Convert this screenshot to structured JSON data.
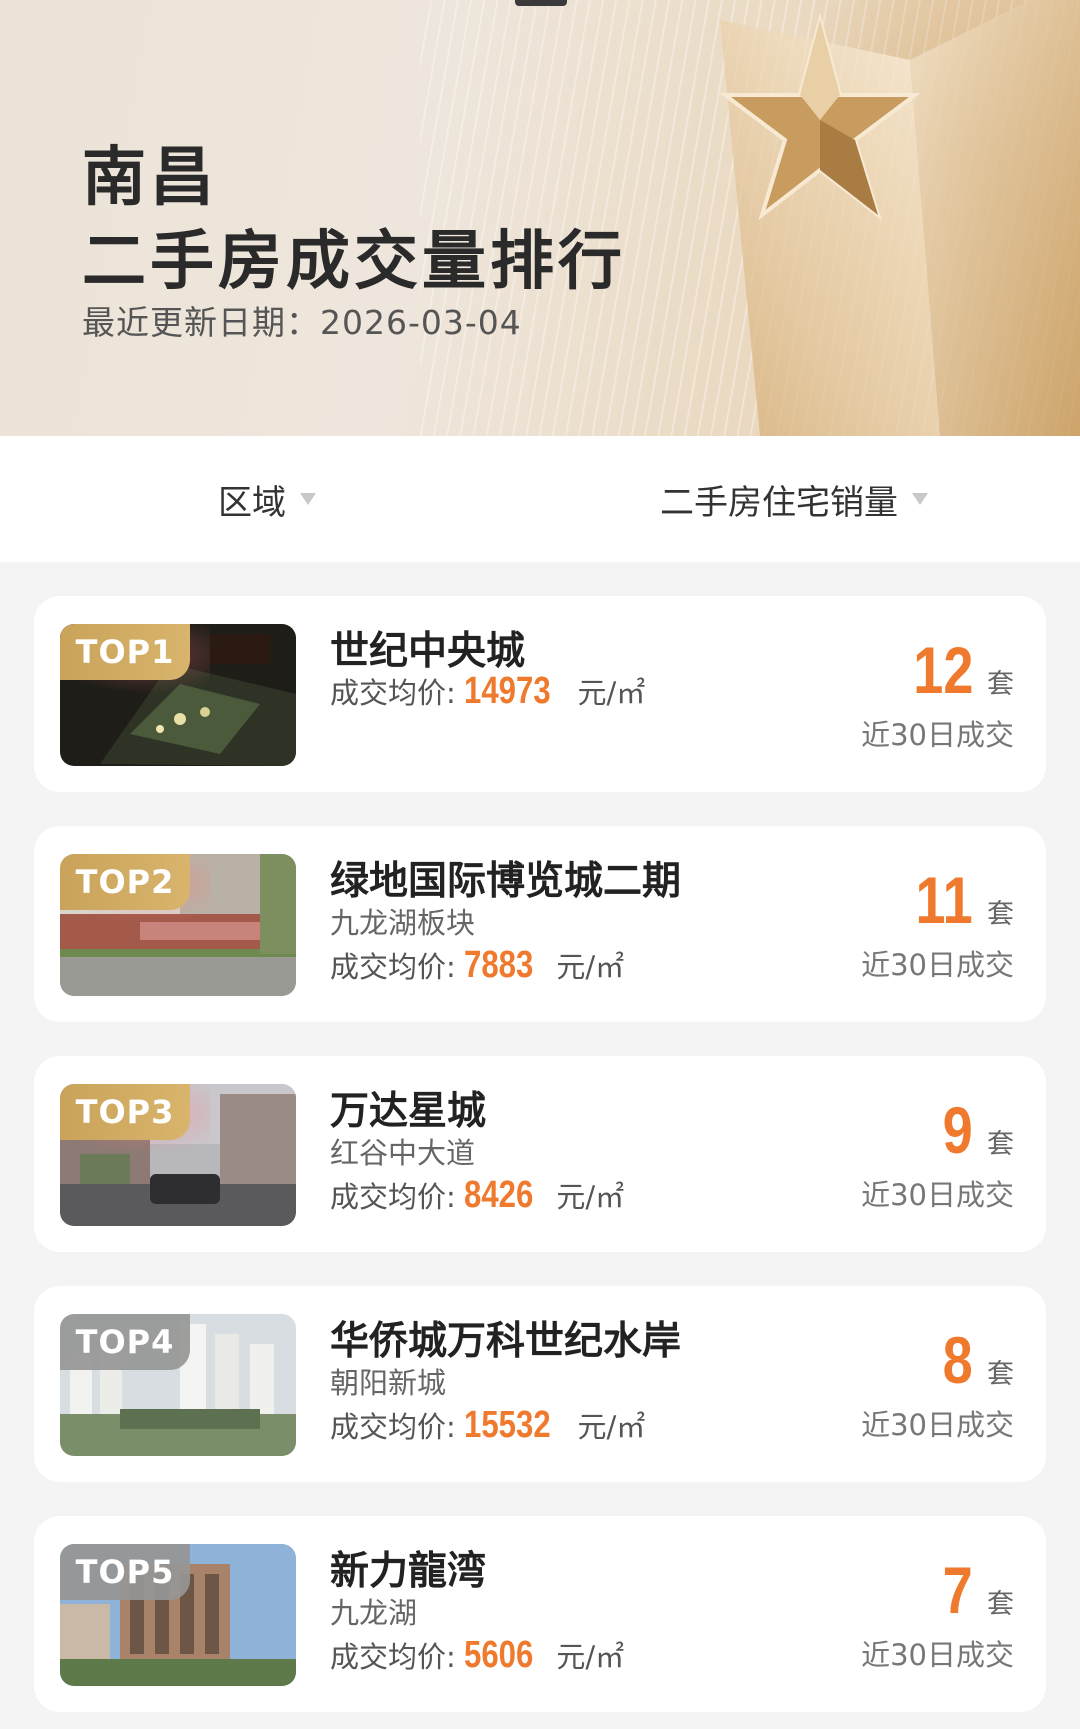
{
  "header": {
    "city": "南昌",
    "title": "二手房成交量排行",
    "update_date": "最近更新日期：2026-03-04"
  },
  "filters": {
    "region_label": "区域",
    "metric_label": "二手房住宅销量"
  },
  "labels": {
    "price_label": "成交均价:",
    "price_unit": "元/㎡",
    "count_unit": "套",
    "count_caption": "近30日成交"
  },
  "colors": {
    "accent": "#ef7a2e",
    "gold_badge": "#c9a35a",
    "gray_badge": "#969696"
  },
  "listings": [
    {
      "rank": "TOP1",
      "name": "世纪中央城",
      "area": "",
      "price": "14973",
      "count": "12",
      "badge_style": "gold"
    },
    {
      "rank": "TOP2",
      "name": "绿地国际博览城二期",
      "area": "九龙湖板块",
      "price": "7883",
      "count": "11",
      "badge_style": "gold"
    },
    {
      "rank": "TOP3",
      "name": "万达星城",
      "area": "红谷中大道",
      "price": "8426",
      "count": "9",
      "badge_style": "gold"
    },
    {
      "rank": "TOP4",
      "name": "华侨城万科世纪水岸",
      "area": "朝阳新城",
      "price": "15532",
      "count": "8",
      "badge_style": "gray"
    },
    {
      "rank": "TOP5",
      "name": "新力龍湾",
      "area": "九龙湖",
      "price": "5606",
      "count": "7",
      "badge_style": "gray"
    }
  ]
}
